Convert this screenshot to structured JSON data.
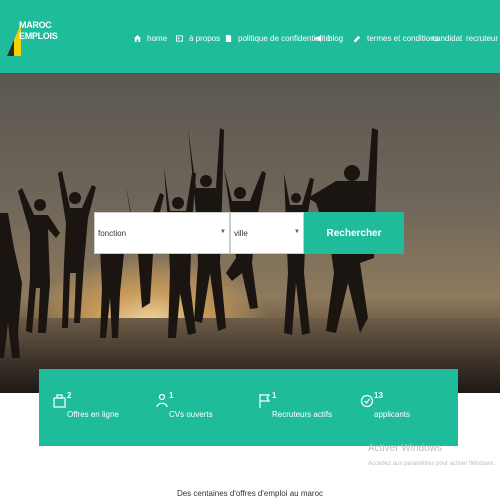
{
  "brand": {
    "line1": "MAROC",
    "line2": "EMPLOIS"
  },
  "nav": [
    {
      "label": "home",
      "icon": "home-icon"
    },
    {
      "label": "à propos",
      "icon": "id-card-icon"
    },
    {
      "label": "politique de confidentialité",
      "icon": "document-icon"
    },
    {
      "label": "blog",
      "icon": "megaphone-icon"
    },
    {
      "label": "termes et conditions",
      "icon": "edit-icon"
    },
    {
      "label": "candidat",
      "icon": ""
    },
    {
      "label": "recruteur",
      "icon": ""
    }
  ],
  "search": {
    "function_placeholder": "fonction",
    "city_placeholder": "ville",
    "button_label": "Rechercher"
  },
  "stats": [
    {
      "value": "2",
      "label": "Offres en ligne",
      "icon": "briefcase-icon"
    },
    {
      "value": "1",
      "label": "CVs ouverts",
      "icon": "users-icon"
    },
    {
      "value": "1",
      "label": "Recruteurs actifs",
      "icon": "flag-icon"
    },
    {
      "value": "13",
      "label": "applicants",
      "icon": "check-circle-icon"
    }
  ],
  "windows_watermark": {
    "title": "Activer Windows",
    "subtitle": "Accédez aux paramètres pour activer Windows."
  },
  "footer": {
    "tagline": "Des centaines d'offres d'emploi au maroc"
  },
  "colors": {
    "accent": "#1fbc9c",
    "logo_yellow": "#f2d200"
  }
}
